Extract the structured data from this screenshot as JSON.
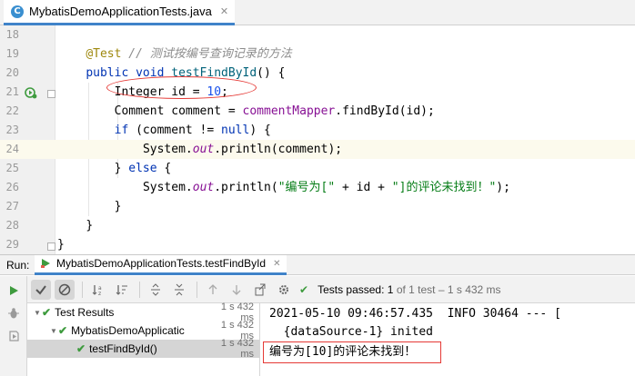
{
  "editor_tab": {
    "icon": "class-c-icon",
    "label": "MybatisDemoApplicationTests.java",
    "close": "✕"
  },
  "editor": {
    "current_line": 24,
    "lines": [
      {
        "n": "18",
        "tokens": []
      },
      {
        "n": "19",
        "tokens": [
          [
            "an",
            "@Test"
          ],
          [
            "",
            " "
          ],
          [
            "cm",
            "// 测试按编号查询记录的方法"
          ]
        ]
      },
      {
        "n": "20",
        "tokens": [
          [
            "kw",
            "public"
          ],
          [
            "",
            " "
          ],
          [
            "kw",
            "void"
          ],
          [
            "",
            " "
          ],
          [
            "fnd",
            "testFindById"
          ],
          [
            "",
            "() {"
          ]
        ]
      },
      {
        "n": "21",
        "tokens": [
          [
            "",
            "Integer id = "
          ],
          [
            "num",
            "10"
          ],
          [
            "",
            ";"
          ]
        ]
      },
      {
        "n": "22",
        "tokens": [
          [
            "",
            "Comment comment = "
          ],
          [
            "fld",
            "commentMapper"
          ],
          [
            "",
            ".findById(id);"
          ]
        ]
      },
      {
        "n": "23",
        "tokens": [
          [
            "kw",
            "if"
          ],
          [
            "",
            " (comment != "
          ],
          [
            "kw",
            "null"
          ],
          [
            "",
            ") {"
          ]
        ]
      },
      {
        "n": "24",
        "tokens": [
          [
            "",
            "System."
          ],
          [
            "sfld",
            "out"
          ],
          [
            "",
            ".println(comment);"
          ]
        ]
      },
      {
        "n": "25",
        "tokens": [
          [
            "",
            "} "
          ],
          [
            "kw",
            "else"
          ],
          [
            "",
            " {"
          ]
        ]
      },
      {
        "n": "26",
        "tokens": [
          [
            "",
            "System."
          ],
          [
            "sfld",
            "out"
          ],
          [
            "",
            ".println("
          ],
          [
            "str",
            "\"编号为[\""
          ],
          [
            "",
            " + id + "
          ],
          [
            "str",
            "\"]的评论未找到！\""
          ],
          [
            "",
            ");"
          ]
        ]
      },
      {
        "n": "27",
        "tokens": [
          [
            "",
            "}"
          ]
        ]
      },
      {
        "n": "28",
        "tokens": [
          [
            "",
            "}"
          ]
        ]
      },
      {
        "n": "29",
        "tokens": [
          [
            "",
            "}"
          ]
        ]
      }
    ],
    "indent": [
      0,
      4,
      4,
      8,
      8,
      8,
      12,
      8,
      12,
      8,
      4,
      0
    ],
    "gutter_icon": "run-test-icon"
  },
  "run": {
    "label": "Run:",
    "tab_label": "MybatisDemoApplicationTests.testFindById",
    "tab_icon": "junit-icon",
    "close": "✕",
    "status": {
      "prefix": "Tests passed:",
      "count": "1",
      "suffix": "of 1 test – 1 s 432 ms"
    },
    "toolbar": [
      "show-passed-icon",
      "show-ignored-icon",
      "sort-alphabetically-icon",
      "sort-by-duration-icon",
      "expand-all-icon",
      "collapse-all-icon",
      "previous-icon",
      "next-icon",
      "export-icon",
      "settings-icon"
    ],
    "side": [
      "rerun-icon",
      "debug-icon",
      "toggle-auto-test-icon"
    ]
  },
  "tree": [
    {
      "name": "Test Results",
      "time": "1 s 432 ms",
      "level": 0,
      "arrow": "▼"
    },
    {
      "name": "MybatisDemoApplicatic",
      "time": "1 s 432 ms",
      "level": 1,
      "arrow": "▼"
    },
    {
      "name": "testFindById()",
      "time": "1 s 432 ms",
      "level": 2,
      "arrow": ""
    }
  ],
  "console": {
    "lines": [
      "2021-05-10 09:46:57.435  INFO 30464 --- [",
      "  {dataSource-1} inited",
      "编号为[10]的评论未找到！"
    ]
  },
  "colors": {
    "accent": "#4083c9",
    "pass": "#3e9b3e",
    "annotation": "#e53935"
  }
}
